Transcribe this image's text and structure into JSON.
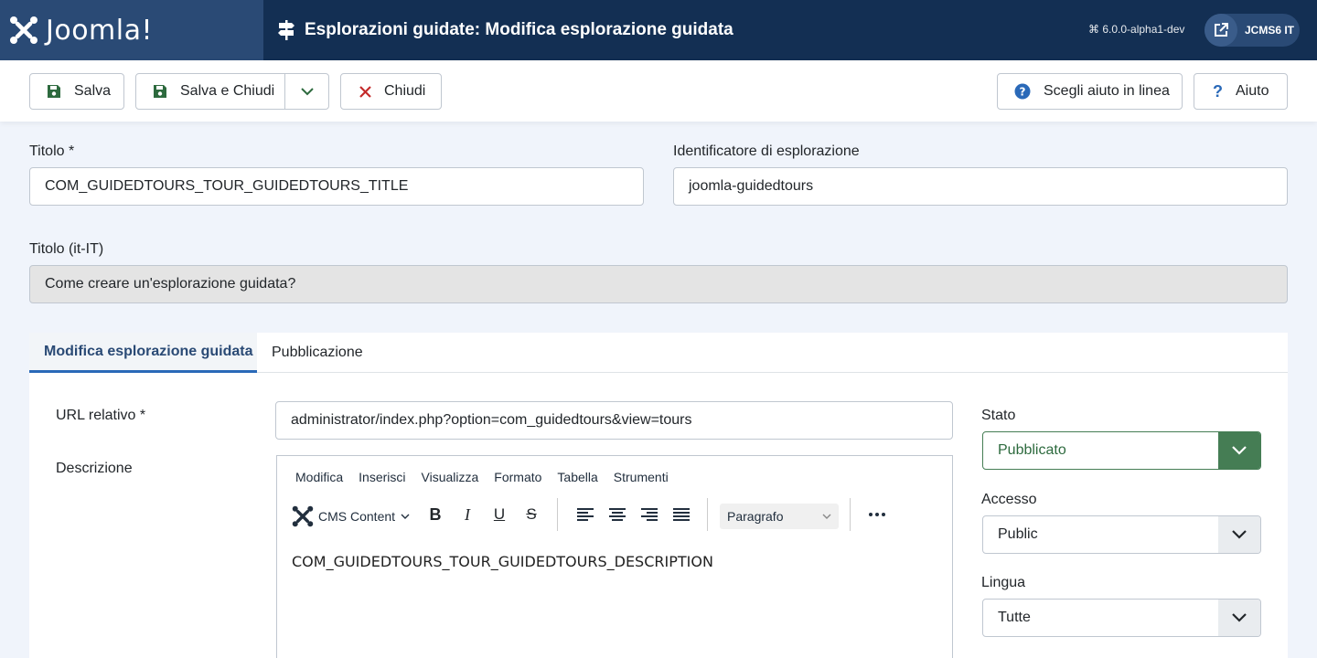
{
  "header": {
    "logo_text": "Joomla!",
    "title": "Esplorazioni guidate: Modifica esplorazione guidata",
    "version": "⌘ 6.0.0-alpha1-dev",
    "site_label": "JCMS6 IT"
  },
  "toolbar": {
    "save": "Salva",
    "save_close": "Salva e Chiudi",
    "close": "Chiudi",
    "help_choose": "Scegli aiuto in linea",
    "help": "Aiuto"
  },
  "form": {
    "title_label": "Titolo *",
    "title_value": "COM_GUIDEDTOURS_TOUR_GUIDEDTOURS_TITLE",
    "uid_label": "Identificatore di esplorazione",
    "uid_value": "joomla-guidedtours",
    "title_lang_label": "Titolo (it-IT)",
    "title_lang_value": "Come creare un'esplorazione guidata?"
  },
  "tabs": [
    "Modifica esplorazione guidata",
    "Pubblicazione"
  ],
  "main": {
    "url_label": "URL relativo *",
    "url_value": "administrator/index.php?option=com_guidedtours&view=tours",
    "desc_label": "Descrizione"
  },
  "editor": {
    "menus": [
      "Modifica",
      "Inserisci",
      "Visualizza",
      "Formato",
      "Tabella",
      "Strumenti"
    ],
    "cms_content": "CMS Content",
    "paragraph": "Paragrafo",
    "content": "COM_GUIDEDTOURS_TOUR_GUIDEDTOURS_DESCRIPTION"
  },
  "side": {
    "state_label": "Stato",
    "state_value": "Pubblicato",
    "access_label": "Accesso",
    "access_value": "Public",
    "lang_label": "Lingua",
    "lang_value": "Tutte"
  },
  "colors": {
    "header_bg": "#132f53",
    "logo_bg": "#2a4a75",
    "published_green": "#457d54",
    "close_red": "#c42b2b",
    "help_blue": "#2a69b8"
  }
}
